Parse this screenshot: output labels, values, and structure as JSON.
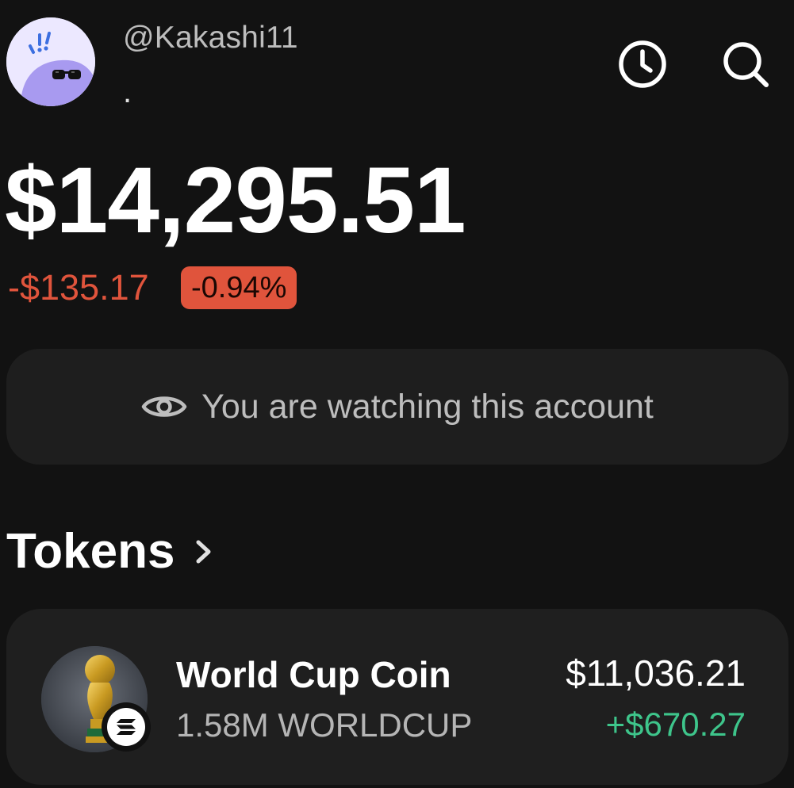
{
  "header": {
    "username": "@Kakashi11",
    "subline": ".",
    "icons": [
      "history-clock-icon",
      "search-icon"
    ]
  },
  "portfolio": {
    "balance": "$14,295.51",
    "change_amount": "-$135.17",
    "change_percent": "-0.94%"
  },
  "watch_banner": {
    "icon": "eye-icon",
    "text": "You are watching this account"
  },
  "tokens_section": {
    "title": "Tokens",
    "chevron_icon": "chevron-right-icon",
    "items": [
      {
        "name": "World Cup Coin",
        "amount": "1.58M WORLDCUP",
        "value": "$11,036.21",
        "change": "+$670.27",
        "logo_icon": "world-cup-trophy-icon",
        "chain_badge_icon": "solana-icon"
      }
    ]
  },
  "colors": {
    "background": "#121212",
    "card": "#1f1f1f",
    "negative": "#e0543c",
    "positive": "#3ec58b",
    "muted_text": "#bdbdbd"
  }
}
